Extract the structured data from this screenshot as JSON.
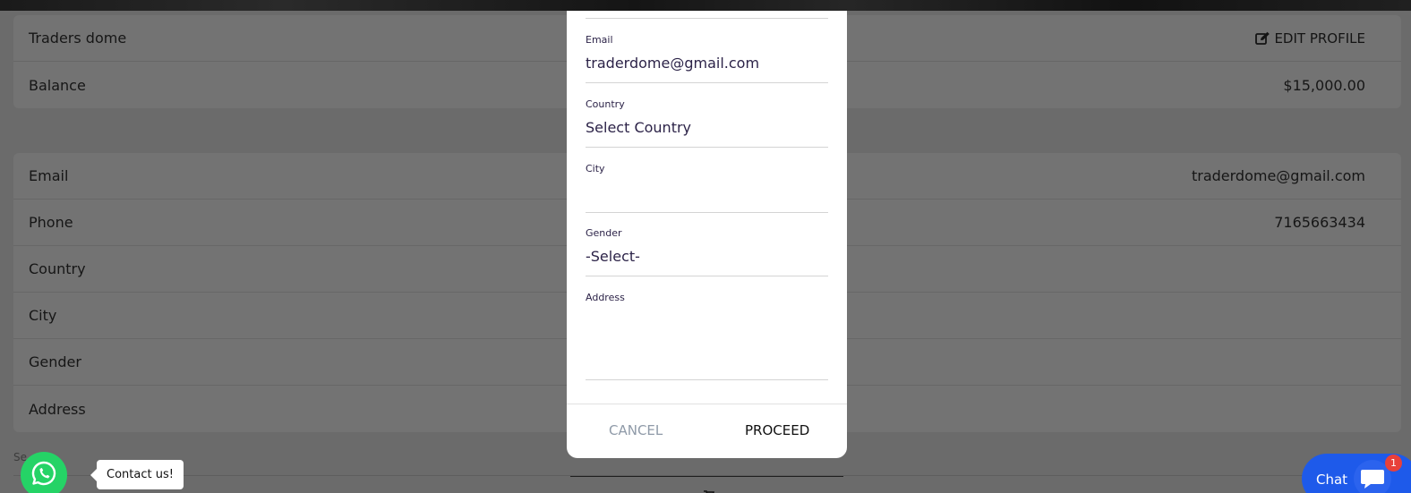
{
  "profile_card": {
    "name": "Traders dome",
    "edit_label": "EDIT PROFILE",
    "balance_label": "Balance",
    "balance_value": "$15,000.00"
  },
  "details_card": {
    "rows": [
      {
        "label": "Email",
        "value": "traderdome@gmail.com"
      },
      {
        "label": "Phone",
        "value": "7165663434"
      },
      {
        "label": "Country",
        "value": ""
      },
      {
        "label": "City",
        "value": ""
      },
      {
        "label": "Gender",
        "value": ""
      },
      {
        "label": "Address",
        "value": ""
      }
    ]
  },
  "footer_text": "Se",
  "modal": {
    "fields": [
      {
        "label": "Email",
        "value": "traderdome@gmail.com"
      },
      {
        "label": "Country",
        "value": "Select Country"
      },
      {
        "label": "City",
        "value": ""
      },
      {
        "label": "Gender",
        "value": "-Select-"
      },
      {
        "label": "Address",
        "value": ""
      }
    ],
    "cancel_label": "CANCEL",
    "proceed_label": "PROCEED"
  },
  "whatsapp": {
    "tooltip": "Contact us!"
  },
  "chat_widget": {
    "label": "Chat",
    "badge_count": "1"
  },
  "colors": {
    "overlay": "#6b6b6b",
    "whatsapp_green": "#25d366",
    "chat_blue": "#1e5aea",
    "badge_red": "#e8403a",
    "modal_text": "#2c2348"
  }
}
